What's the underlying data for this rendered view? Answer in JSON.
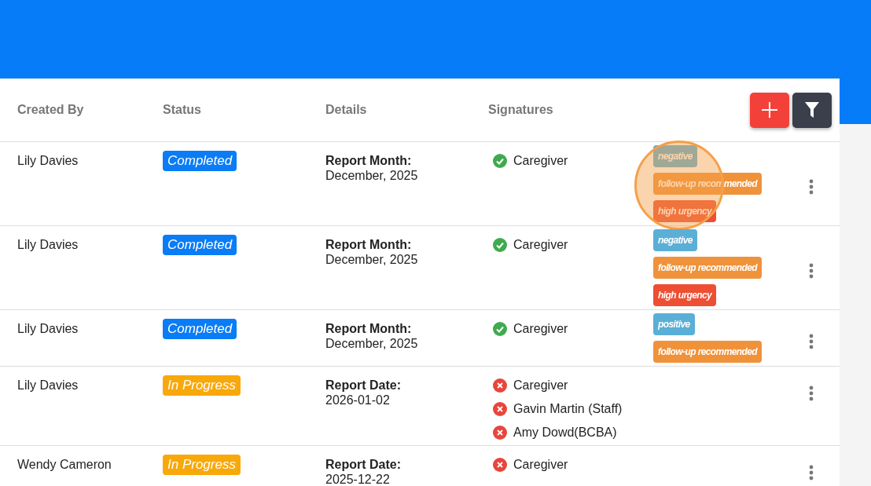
{
  "table": {
    "columns": [
      "Created By",
      "Status",
      "Details",
      "Signatures"
    ],
    "rows": [
      {
        "created_by": "Lily Davies",
        "status": {
          "label": "Completed",
          "kind": "completed"
        },
        "detail_label": "Report Month:",
        "detail_value": "December, 2025",
        "signatures": [
          {
            "name": "Caregiver",
            "signed": true
          }
        ],
        "tags": [
          {
            "label": "negative",
            "color": "#5bafd6"
          },
          {
            "label": "follow-up recommended",
            "color": "#f0923a"
          },
          {
            "label": "high urgency",
            "color": "#ee4f33"
          }
        ],
        "highlighted": true
      },
      {
        "created_by": "Lily Davies",
        "status": {
          "label": "Completed",
          "kind": "completed"
        },
        "detail_label": "Report Month:",
        "detail_value": "December, 2025",
        "signatures": [
          {
            "name": "Caregiver",
            "signed": true
          }
        ],
        "tags": [
          {
            "label": "negative",
            "color": "#5bafd6"
          },
          {
            "label": "follow-up recommended",
            "color": "#f0923a"
          },
          {
            "label": "high urgency",
            "color": "#ee4f33"
          }
        ],
        "highlighted": false
      },
      {
        "created_by": "Lily Davies",
        "status": {
          "label": "Completed",
          "kind": "completed"
        },
        "detail_label": "Report Month:",
        "detail_value": "December, 2025",
        "signatures": [
          {
            "name": "Caregiver",
            "signed": true
          }
        ],
        "tags": [
          {
            "label": "positive",
            "color": "#5bafd6"
          },
          {
            "label": "follow-up recommended",
            "color": "#f0923a"
          }
        ],
        "highlighted": false
      },
      {
        "created_by": "Lily Davies",
        "status": {
          "label": "In Progress",
          "kind": "in_progress"
        },
        "detail_label": "Report Date:",
        "detail_value": "2026-01-02",
        "signatures": [
          {
            "name": "Caregiver",
            "signed": false
          },
          {
            "name": "Gavin Martin (Staff)",
            "signed": false
          },
          {
            "name": "Amy Dowd(BCBA)",
            "signed": false
          }
        ],
        "tags": [],
        "highlighted": false
      },
      {
        "created_by": "Wendy Cameron",
        "status": {
          "label": "In Progress",
          "kind": "in_progress"
        },
        "detail_label": "Report Date:",
        "detail_value": "2025-12-22",
        "signatures": [
          {
            "name": "Caregiver",
            "signed": false
          }
        ],
        "tags": [],
        "highlighted": false
      }
    ]
  }
}
